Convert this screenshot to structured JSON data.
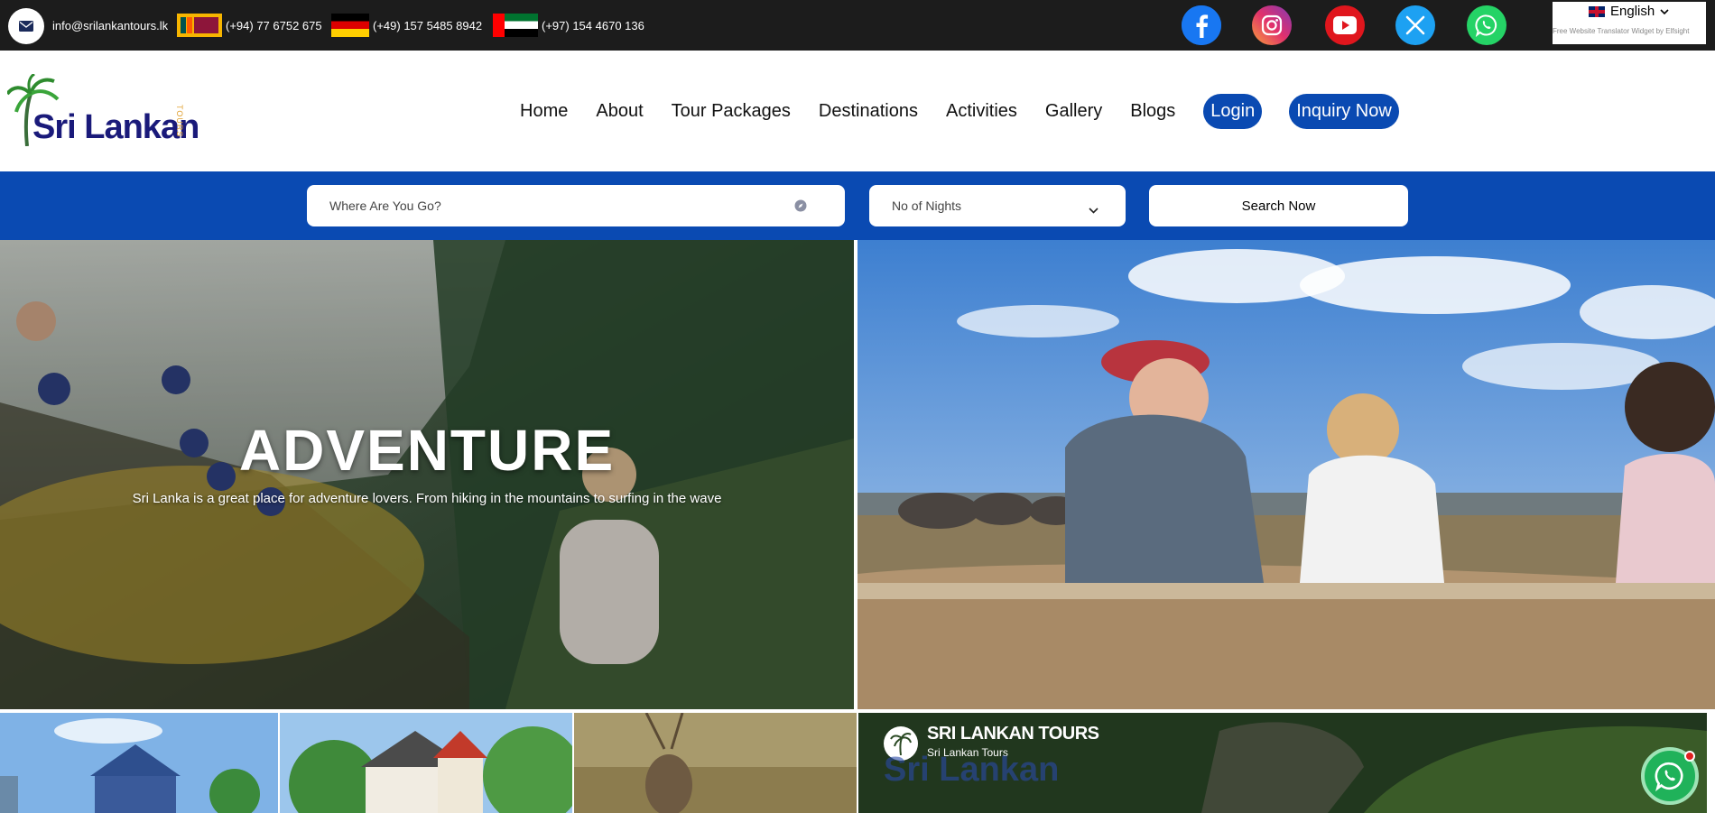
{
  "topbar": {
    "email": "info@srilankantours.lk",
    "phones": [
      {
        "flag": "sri-lanka",
        "number": "(+94) 77 6752 675"
      },
      {
        "flag": "germany",
        "number": "(+49) 157 5485 8942"
      },
      {
        "flag": "uae",
        "number": "(+97) 154 4670 136"
      }
    ],
    "social_icons": [
      "facebook-icon",
      "instagram-icon",
      "youtube-icon",
      "x-icon",
      "whatsapp-icon"
    ],
    "language": {
      "selected": "English",
      "credit": "Free Website Translator Widget by Elfsight"
    }
  },
  "header": {
    "logo": {
      "text": "Sri Lankan",
      "sub": "TOURS"
    },
    "nav": [
      "Home",
      "About",
      "Tour Packages",
      "Destinations",
      "Activities",
      "Gallery",
      "Blogs"
    ],
    "login_label": "Login",
    "inquiry_label": "Inquiry Now"
  },
  "search": {
    "destination_placeholder": "Where Are You Go?",
    "nights_selected": "No of Nights",
    "button_label": "Search Now"
  },
  "hero": {
    "left": {
      "title": "ADVENTURE",
      "subtitle": "Sri Lanka is a great place for adventure lovers. From hiking in the mountains to surfing in the wave"
    }
  },
  "video_card": {
    "title": "SRI LANKAN TOURS",
    "channel": "Sri Lankan Tours",
    "logo_text": "Sri Lankan"
  },
  "colors": {
    "primary_blue": "#0a4ab2",
    "topbar": "#1c1c1c",
    "whatsapp": "#20b25a"
  }
}
